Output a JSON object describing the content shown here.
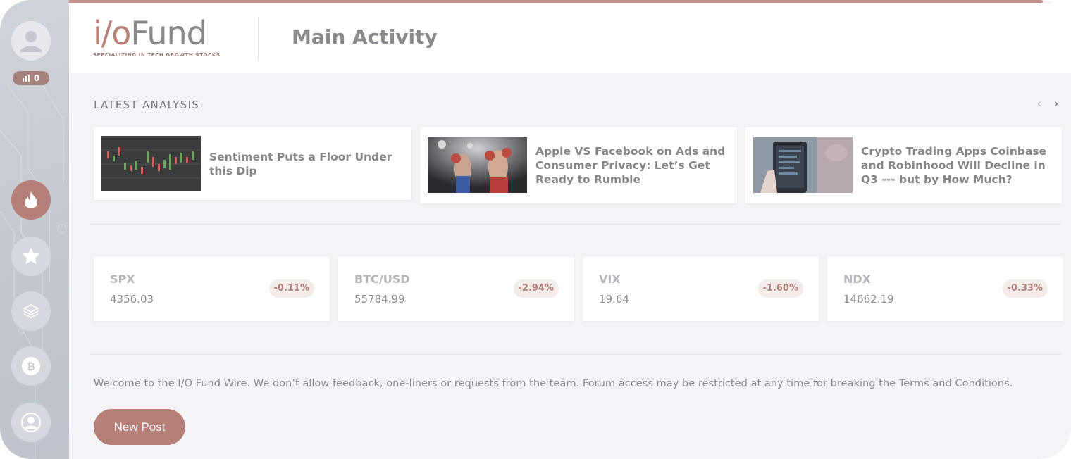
{
  "brand": {
    "logo_text_io": "i/o",
    "logo_text_fund": "Fund",
    "tagline": "SPECIALIZING IN TECH GROWTH STOCKS",
    "accent_color": "#b57e76"
  },
  "header": {
    "title": "Main Activity"
  },
  "sidebar": {
    "badge_count": "0",
    "nav": [
      {
        "name": "flame-icon",
        "active": true
      },
      {
        "name": "star-icon",
        "active": false
      },
      {
        "name": "layers-icon",
        "active": false
      },
      {
        "name": "bitcoin-icon",
        "active": false
      },
      {
        "name": "user-circle-icon",
        "active": false
      }
    ]
  },
  "latest_analysis": {
    "label": "LATEST ANALYSIS",
    "articles": [
      {
        "title": "Sentiment Puts a Floor Under this Dip",
        "image": "candlestick-chart-thumbnail"
      },
      {
        "title": "Apple VS Facebook on Ads and Consumer Privacy: Let’s Get Ready to Rumble",
        "image": "boxing-match-thumbnail"
      },
      {
        "title": "Crypto Trading Apps Coinbase and Robinhood Will Decline in Q3 --- but by How Much?",
        "image": "phone-trading-app-thumbnail"
      }
    ]
  },
  "tickers": [
    {
      "symbol": "SPX",
      "price": "4356.03",
      "change": "-0.11%"
    },
    {
      "symbol": "BTC/USD",
      "price": "55784.99",
      "change": "-2.94%"
    },
    {
      "symbol": "VIX",
      "price": "19.64",
      "change": "-1.60%"
    },
    {
      "symbol": "NDX",
      "price": "14662.19",
      "change": "-0.33%"
    }
  ],
  "welcome_text": "Welcome to the I/O Fund Wire. We don’t allow feedback, one-liners or requests from the team. Forum access may be restricted at any time for breaking the Terms and Conditions.",
  "new_post_label": "New Post"
}
